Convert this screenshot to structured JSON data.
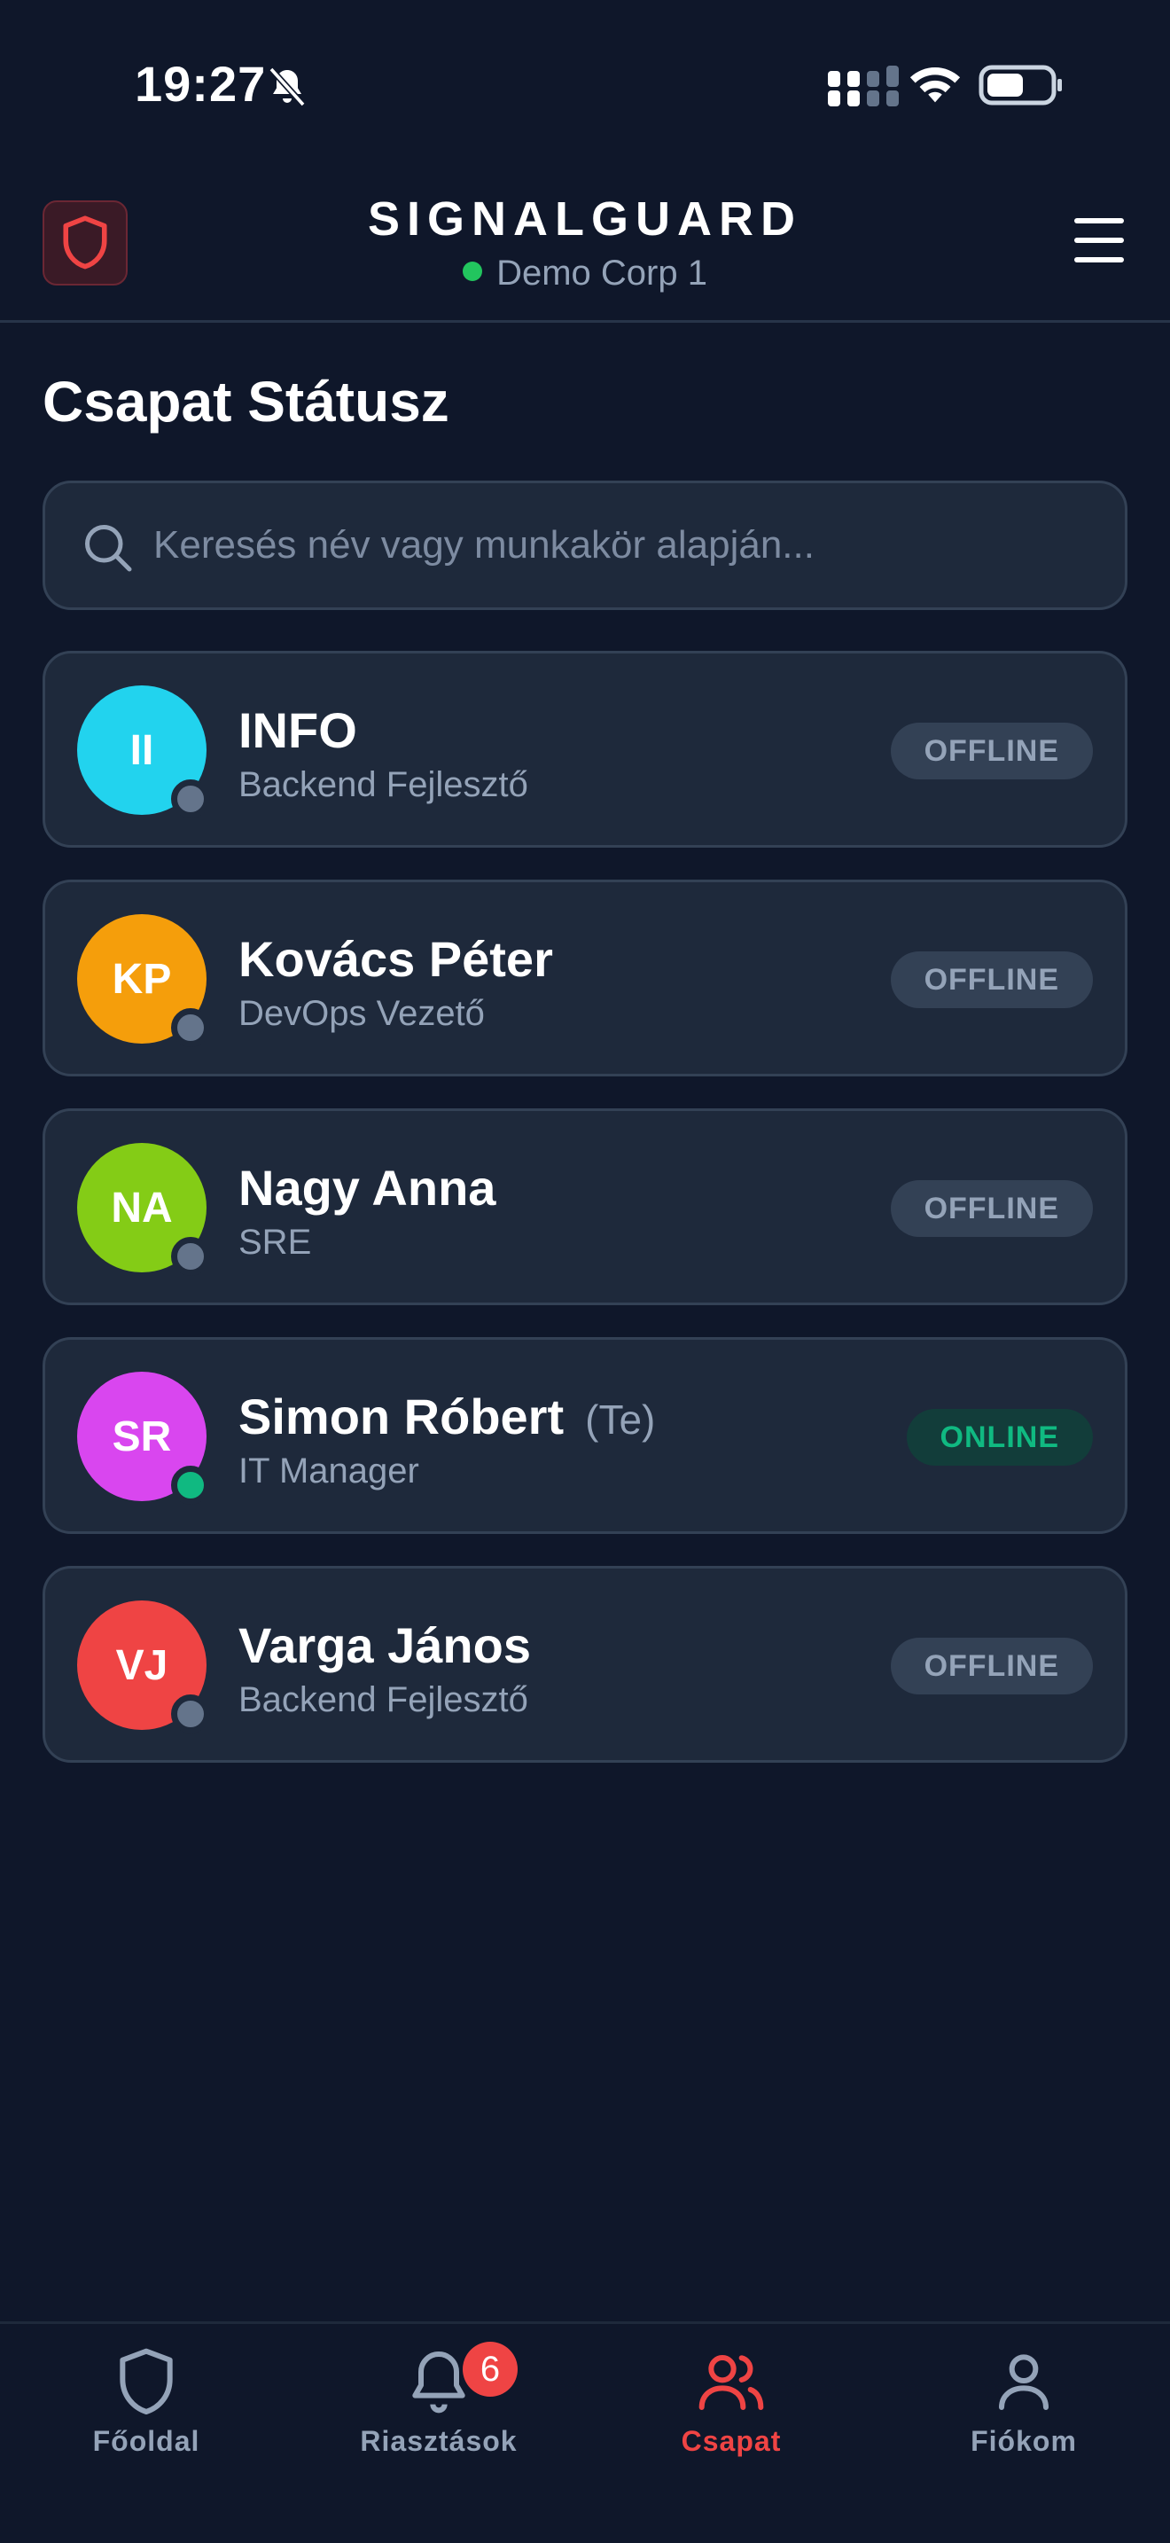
{
  "status_bar": {
    "time": "19:27"
  },
  "header": {
    "brand": "SIGNALGUARD",
    "organization": "Demo Corp 1",
    "logo_icon": "shield-icon",
    "menu_icon": "hamburger-menu-icon"
  },
  "page": {
    "title": "Csapat Státusz",
    "search": {
      "placeholder": "Keresés név vagy munkakör alapján...",
      "value": ""
    }
  },
  "members": [
    {
      "initials": "II",
      "name": "INFO",
      "you_label": "",
      "role": "Backend Fejlesztő",
      "status": "OFFLINE",
      "avatar_color": "#22d3ee",
      "online": false
    },
    {
      "initials": "KP",
      "name": "Kovács Péter",
      "you_label": "",
      "role": "DevOps Vezető",
      "status": "OFFLINE",
      "avatar_color": "#f59e0b",
      "online": false
    },
    {
      "initials": "NA",
      "name": "Nagy Anna",
      "you_label": "",
      "role": "SRE",
      "status": "OFFLINE",
      "avatar_color": "#84cc16",
      "online": false
    },
    {
      "initials": "SR",
      "name": "Simon Róbert",
      "you_label": "(Te)",
      "role": "IT Manager",
      "status": "ONLINE",
      "avatar_color": "#d946ef",
      "online": true
    },
    {
      "initials": "VJ",
      "name": "Varga János",
      "you_label": "",
      "role": "Backend Fejlesztő",
      "status": "OFFLINE",
      "avatar_color": "#ef4444",
      "online": false
    }
  ],
  "tabbar": {
    "items": [
      {
        "label": "Főoldal",
        "icon": "shield-icon",
        "active": false
      },
      {
        "label": "Riasztások",
        "icon": "bell-icon",
        "active": false,
        "badge": "6"
      },
      {
        "label": "Csapat",
        "icon": "users-icon",
        "active": true
      },
      {
        "label": "Fiókom",
        "icon": "user-icon",
        "active": false
      }
    ]
  },
  "colors": {
    "background": "#0f172a",
    "card": "#1e293b",
    "accent": "#ef4444",
    "online": "#10b981",
    "muted": "#94a3b8"
  }
}
